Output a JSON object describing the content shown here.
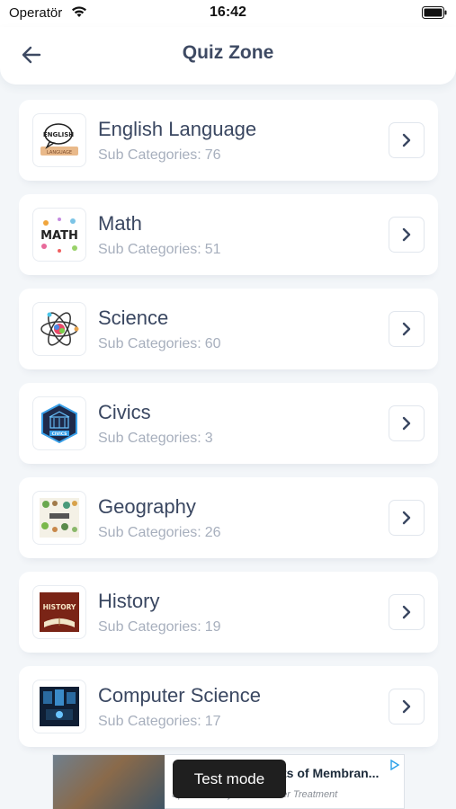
{
  "status_bar": {
    "carrier": "Operatör",
    "time": "16:42"
  },
  "header": {
    "title": "Quiz Zone"
  },
  "categories": [
    {
      "name": "English Language",
      "sub_label": "Sub Categories:",
      "count": "76",
      "thumb_text": "ENGLISH",
      "icon": "english-language-icon"
    },
    {
      "name": "Math",
      "sub_label": "Sub Categories:",
      "count": "51",
      "thumb_text": "MATH",
      "icon": "math-icon"
    },
    {
      "name": "Science",
      "sub_label": "Sub Categories:",
      "count": "60",
      "thumb_text": "",
      "icon": "atom-icon"
    },
    {
      "name": "Civics",
      "sub_label": "Sub Categories:",
      "count": "3",
      "thumb_text": "CIVICS",
      "icon": "civics-icon"
    },
    {
      "name": "Geography",
      "sub_label": "Sub Categories:",
      "count": "26",
      "thumb_text": "",
      "icon": "geography-icon"
    },
    {
      "name": "History",
      "sub_label": "Sub Categories:",
      "count": "19",
      "thumb_text": "HISTORY",
      "icon": "history-icon"
    },
    {
      "name": "Computer Science",
      "sub_label": "Sub Categories:",
      "count": "17",
      "thumb_text": "",
      "icon": "computer-science-icon"
    }
  ],
  "ad": {
    "test_mode": "Test mode",
    "title": "ts of Membran...",
    "sponsor": "Sponsored by: Wastewater Treatment"
  },
  "colors": {
    "background": "#f3f6f9",
    "title": "#3e4a63",
    "subtext": "#a7afbd"
  }
}
